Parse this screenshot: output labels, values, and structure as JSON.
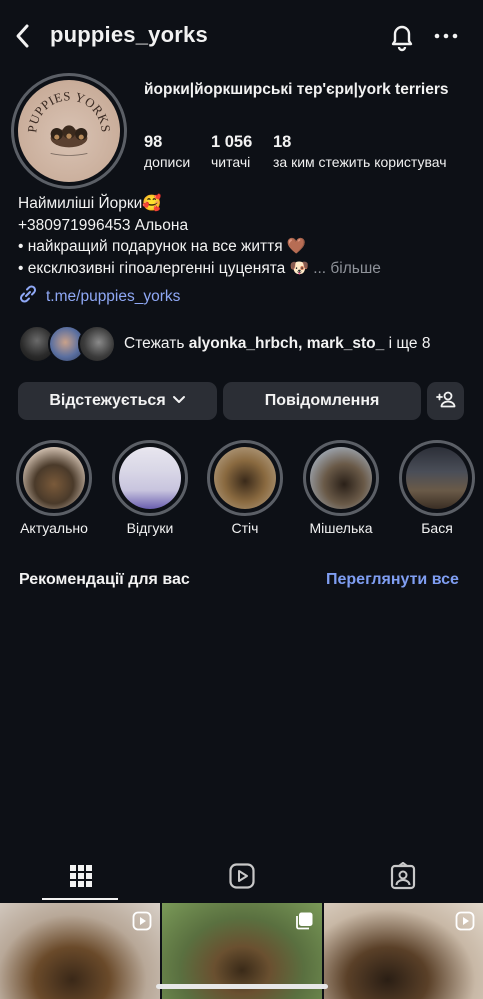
{
  "header": {
    "username": "puppies_yorks"
  },
  "profile": {
    "display_name": "йорки|йоркширські тер'єри|york terriers",
    "avatar_text": "PUPPIES YORKS",
    "stats": [
      {
        "value": "98",
        "label": "дописи"
      },
      {
        "value": "1 056",
        "label": "читачі"
      },
      {
        "value": "18",
        "label": "за ким стежить користувач"
      }
    ],
    "bio": {
      "line1": "Наймиліші Йорки🥰",
      "line2": "+380971996453 Альона",
      "line3": "• найкращий подарунок на все життя 🤎",
      "line4": "• ексклюзивні гіпоалергенні цуценята 🐶",
      "more": "... більше"
    },
    "link": "t.me/puppies_yorks",
    "followed_by": {
      "prefix": "Стежать ",
      "names": "alyonka_hrbch, mark_sto_",
      "suffix": " і ще 8"
    }
  },
  "buttons": {
    "following": "Відстежується",
    "message": "Повідомлення"
  },
  "highlights": [
    {
      "label": "Актуально"
    },
    {
      "label": "Відгуки"
    },
    {
      "label": "Стіч"
    },
    {
      "label": "Мішелька"
    },
    {
      "label": "Бася"
    }
  ],
  "recommendations": {
    "title": "Рекомендації для вас",
    "see_all": "Переглянути все"
  },
  "colors": {
    "background": "#0d1016",
    "button": "#2b2e35",
    "link": "#8fa8f5",
    "accent_blue": "#7f9ef2"
  }
}
